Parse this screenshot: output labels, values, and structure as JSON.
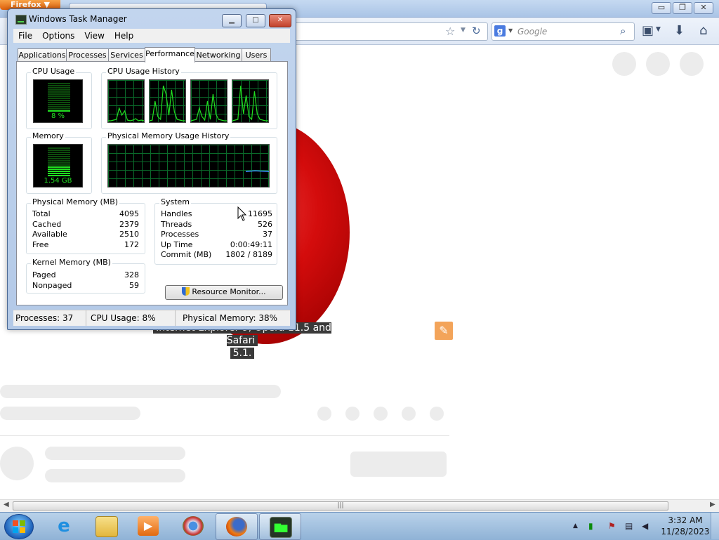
{
  "firefox": {
    "menu_button": "Firefox ▼",
    "window_buttons": [
      "▭",
      "❐",
      "✕"
    ],
    "search": {
      "engine_icon": "g",
      "placeholder": "Google"
    },
    "url_icons": [
      "star-icon",
      "dropdown-icon",
      "reload-icon"
    ],
    "toolbar_icons": [
      "bookmarks-icon",
      "downloads-icon",
      "home-icon"
    ]
  },
  "page": {
    "caption_line1": "Internet Explorer 9, Opera 11.5 and Safari",
    "caption_line2": "5.1."
  },
  "task_manager": {
    "title": "Windows Task Manager",
    "caption_buttons": {
      "minimize": "▁",
      "maximize": "□",
      "close": "✕"
    },
    "menu": [
      "File",
      "Options",
      "View",
      "Help"
    ],
    "tabs": [
      "Applications",
      "Processes",
      "Services",
      "Performance",
      "Networking",
      "Users"
    ],
    "selected_tab": "Performance",
    "cpu_usage": {
      "title": "CPU Usage",
      "value": "8 %",
      "level": 0.08
    },
    "cpu_history": {
      "title": "CPU Usage History"
    },
    "memory": {
      "title": "Memory",
      "value": "1.54 GB",
      "level": 0.38
    },
    "mem_history": {
      "title": "Physical Memory Usage History"
    },
    "physical_memory": {
      "title": "Physical Memory (MB)",
      "rows": [
        {
          "label": "Total",
          "value": "4095"
        },
        {
          "label": "Cached",
          "value": "2379"
        },
        {
          "label": "Available",
          "value": "2510"
        },
        {
          "label": "Free",
          "value": "172"
        }
      ]
    },
    "kernel_memory": {
      "title": "Kernel Memory (MB)",
      "rows": [
        {
          "label": "Paged",
          "value": "328"
        },
        {
          "label": "Nonpaged",
          "value": "59"
        }
      ]
    },
    "system": {
      "title": "System",
      "rows": [
        {
          "label": "Handles",
          "value": "11695"
        },
        {
          "label": "Threads",
          "value": "526"
        },
        {
          "label": "Processes",
          "value": "37"
        },
        {
          "label": "Up Time",
          "value": "0:00:49:11"
        },
        {
          "label": "Commit (MB)",
          "value": "1802 / 8189"
        }
      ]
    },
    "resource_monitor_label": "Resource Monitor...",
    "status": {
      "processes": "Processes: 37",
      "cpu": "CPU Usage: 8%",
      "memory": "Physical Memory: 38%"
    }
  },
  "taskbar": {
    "items": [
      "internet-explorer-icon",
      "explorer-folder-icon",
      "media-player-icon",
      "chrome-icon",
      "firefox-icon",
      "task-manager-icon"
    ],
    "active_items": [
      "firefox-icon",
      "task-manager-icon"
    ],
    "tray_icons": [
      "show-hidden-icons-arrow",
      "cpu-meter-icon",
      "action-center-icon",
      "network-icon",
      "volume-icon"
    ],
    "time": "3:32 AM",
    "date": "11/28/2023"
  },
  "colors": {
    "opera_red": "#d40c0c",
    "meter_green": "#21e021",
    "graph_grid": "#0a6a2a",
    "memory_line": "#3a8cff"
  }
}
